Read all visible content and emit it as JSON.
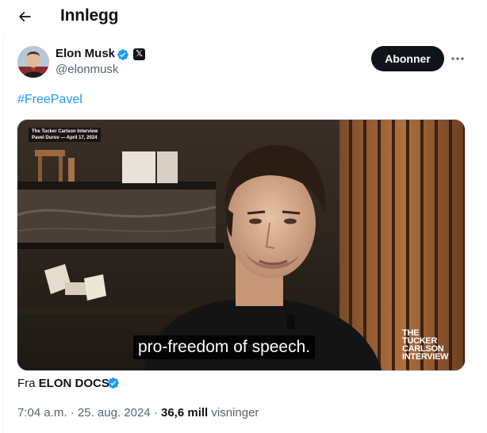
{
  "header": {
    "title": "Innlegg",
    "back_icon": "arrow-left-icon"
  },
  "post": {
    "author": {
      "name": "Elon Musk",
      "handle": "@elonmusk",
      "verified_icon": "verified-badge-icon",
      "affiliate_icon": "x-logo-icon"
    },
    "subscribe_label": "Abonner",
    "more_icon": "more-options-icon",
    "text": "#FreePavel",
    "media": {
      "top_caption_line1": "The Tucker Carlson Interview",
      "top_caption_line2": "Pavel Durov — April 17, 2024",
      "subtitle": "pro-freedom of speech.",
      "watermark": [
        "THE",
        "TUCKER",
        "CARLSON",
        "INTERVIEW"
      ]
    },
    "source_prefix": "Fra",
    "source_name": "ELON DOCS",
    "time": "7:04 a.m.",
    "separator": "·",
    "date": "25. aug. 2024",
    "views_count": "36,6 mill",
    "views_label": "visninger"
  },
  "colors": {
    "accent": "#1d9bf0",
    "text_primary": "#0f1419",
    "text_secondary": "#536471",
    "button_bg": "#0f1419"
  }
}
